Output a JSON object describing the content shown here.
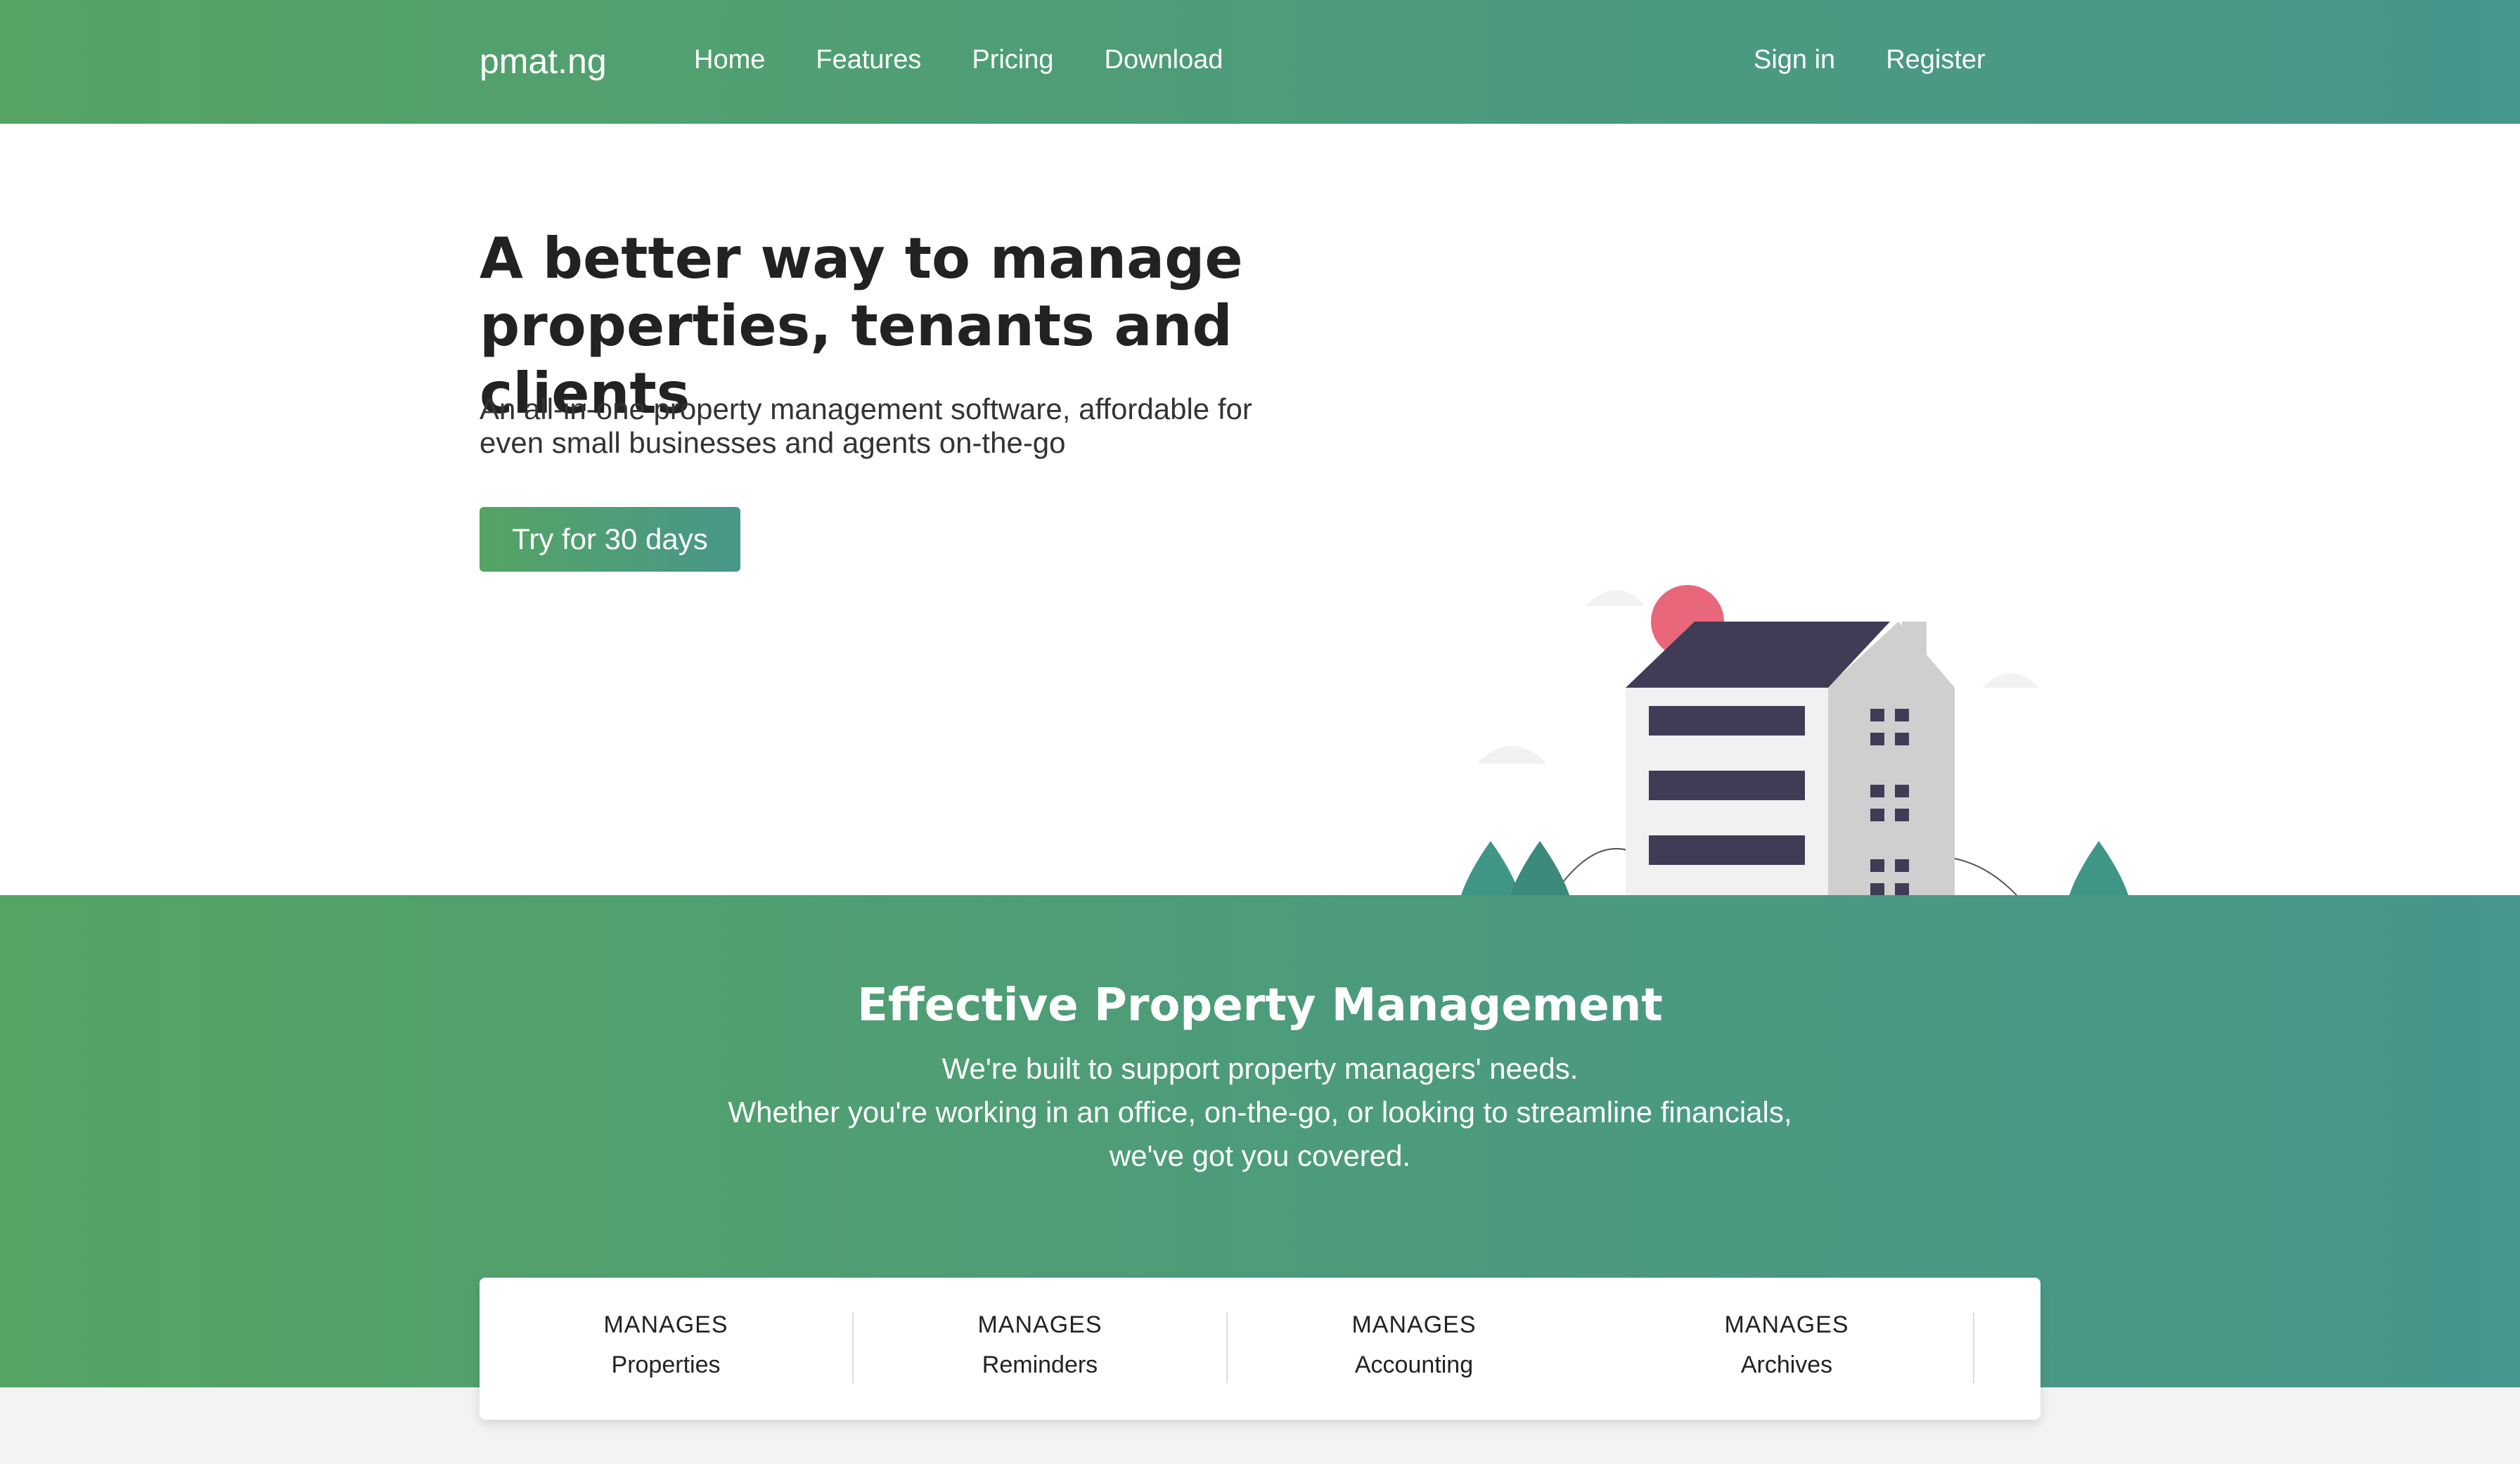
{
  "nav": {
    "brand": "pmat.ng",
    "links": [
      "Home",
      "Features",
      "Pricing",
      "Download"
    ],
    "auth": [
      "Sign in",
      "Register"
    ]
  },
  "hero": {
    "title_line1": "A better way to manage",
    "title_line2": "properties, tenants and clients",
    "sub_line1": "An all-in-one property management software, affordable for",
    "sub_line2": "even small businesses and agents on-the-go",
    "cta": "Try for 30 days"
  },
  "band": {
    "title": "Effective Property Management",
    "lines": [
      "We're built to support property managers' needs.",
      "Whether you're working in an office, on-the-go, or looking to streamline financials,",
      "we've got you covered."
    ]
  },
  "card": {
    "items": [
      {
        "k": "MANAGES",
        "v": "Properties"
      },
      {
        "k": "MANAGES",
        "v": "Reminders"
      },
      {
        "k": "MANAGES",
        "v": "Accounting"
      },
      {
        "k": "MANAGES",
        "v": "Archives"
      }
    ]
  },
  "colors": {
    "grad_start": "#55a464",
    "grad_end": "#46978c",
    "dark": "#3f3c56",
    "tree": "#3f9687",
    "sun": "#e8677a"
  }
}
